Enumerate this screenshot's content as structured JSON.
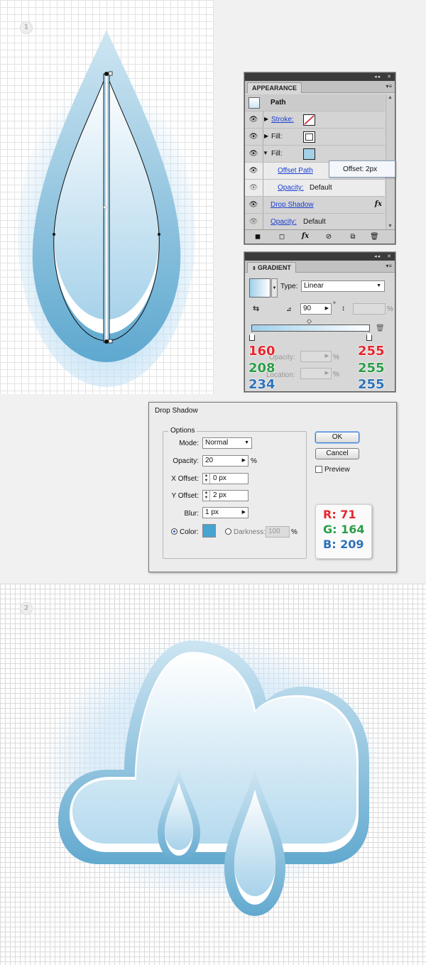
{
  "steps": {
    "step1": "1",
    "step2": "2"
  },
  "appearance_panel": {
    "title": "APPEARANCE",
    "header_label": "Path",
    "stroke_label": "Stroke:",
    "fill1_label": "Fill:",
    "fill2_label": "Fill:",
    "offset_path_label": "Offset Path",
    "offset_tooltip": "Offset: 2px",
    "opacity1_label": "Opacity:",
    "opacity1_value": "Default",
    "drop_shadow_label": "Drop Shadow",
    "fx_symbol": "fx",
    "opacity2_label": "Opacity:",
    "opacity2_value": "Default",
    "collapse_icon": "◂◂",
    "close_icon": "✕",
    "menu_icon": "▾≡"
  },
  "gradient_panel": {
    "title": "GRADIENT",
    "type_label": "Type:",
    "type_value": "Linear",
    "angle_value": "90",
    "degree": "°",
    "percent": "%",
    "opacity_label": "Opacity:",
    "location_label": "Location:",
    "left_stop": {
      "r": "160",
      "g": "208",
      "b": "234"
    },
    "right_stop": {
      "r": "255",
      "g": "255",
      "b": "255"
    },
    "colors": {
      "left": "#a0d0ea",
      "right": "#ffffff"
    }
  },
  "drop_shadow_dialog": {
    "title": "Drop Shadow",
    "options_legend": "Options",
    "mode_label": "Mode:",
    "mode_value": "Normal",
    "opacity_label": "Opacity:",
    "opacity_value": "20",
    "opacity_unit": "%",
    "x_offset_label": "X Offset:",
    "x_offset_value": "0 px",
    "y_offset_label": "Y Offset:",
    "y_offset_value": "2 px",
    "blur_label": "Blur:",
    "blur_value": "1 px",
    "color_label": "Color:",
    "darkness_label": "Darkness:",
    "darkness_value": "100",
    "darkness_unit": "%",
    "ok_label": "OK",
    "cancel_label": "Cancel",
    "preview_label": "Preview",
    "color_swatch": "#47a4d1",
    "rgb": {
      "r": "R: 71",
      "g": "G: 164",
      "b": "B: 209"
    }
  }
}
